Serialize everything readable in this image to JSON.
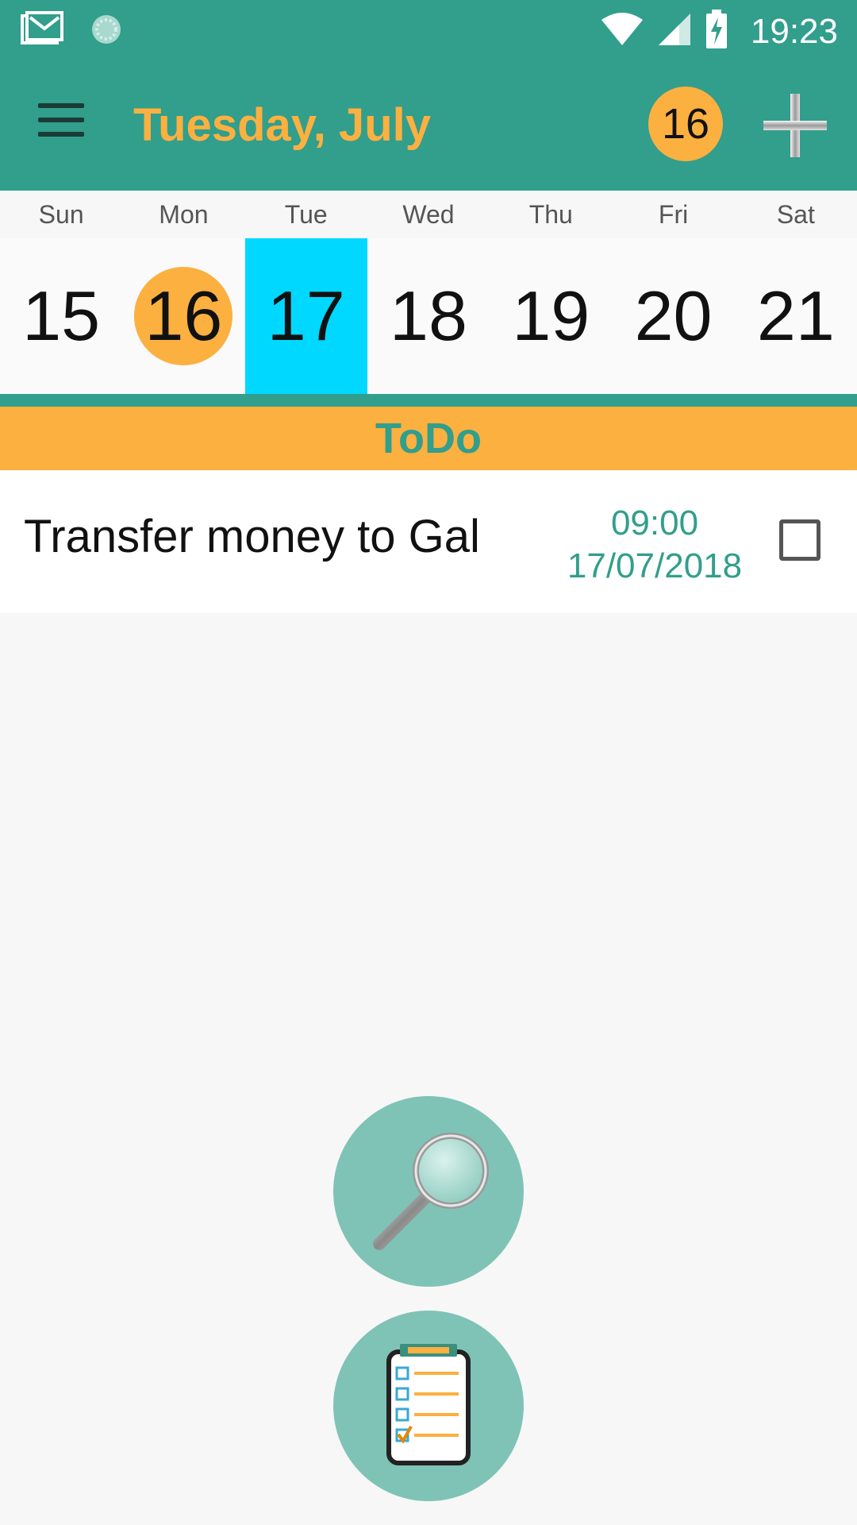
{
  "status_bar": {
    "time": "19:23",
    "icons": [
      "gmail-icon",
      "loading-icon",
      "wifi-icon",
      "signal-icon",
      "battery-charging-icon"
    ]
  },
  "toolbar": {
    "title": "Tuesday, July",
    "today_badge": "16",
    "icons": [
      "menu-icon",
      "add-icon"
    ]
  },
  "calendar": {
    "weekdays": [
      "Sun",
      "Mon",
      "Tue",
      "Wed",
      "Thu",
      "Fri",
      "Sat"
    ],
    "dates": [
      "15",
      "16",
      "17",
      "18",
      "19",
      "20",
      "21"
    ],
    "today": "16",
    "selected": "17"
  },
  "section": {
    "title": "ToDo"
  },
  "tasks": [
    {
      "title": "Transfer money to Gal",
      "time": "09:00",
      "date": "17/07/2018",
      "checked": false
    }
  ],
  "fabs": [
    "search-icon",
    "reminders-icon"
  ],
  "colors": {
    "primary": "#329e8c",
    "accent": "#fbb040",
    "selected": "#00d8ff",
    "fab": "#7fc3b6"
  }
}
